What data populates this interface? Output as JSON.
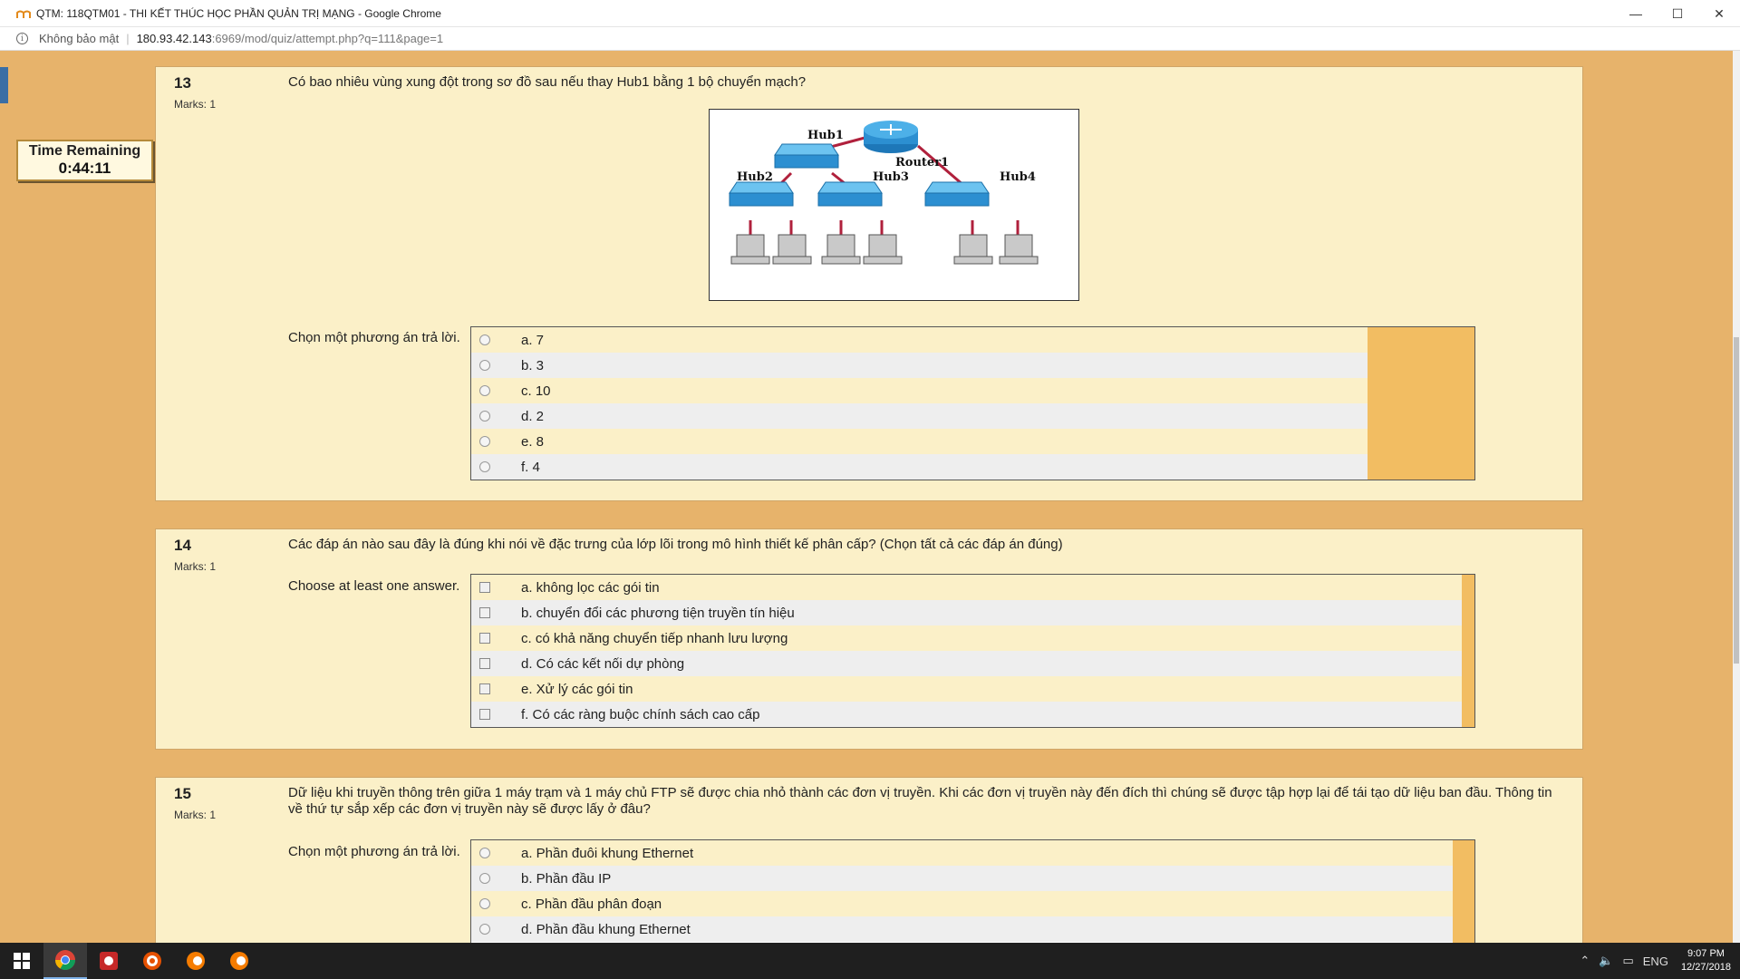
{
  "window": {
    "title": "QTM: 118QTM01 - THI KẾT THÚC HỌC PHẦN QUẢN TRỊ MẠNG - Google Chrome",
    "controls": {
      "minimize": "—",
      "maximize": "☐",
      "close": "✕"
    }
  },
  "address": {
    "security": "Không bảo mật",
    "host": "180.93.42.143",
    "path": ":6969/mod/quiz/attempt.php?q=111&page=1"
  },
  "timer": {
    "label": "Time Remaining",
    "value": "0:44:11"
  },
  "questions": [
    {
      "number": "13",
      "marks": "Marks: 1",
      "text": "Có bao nhiêu vùng xung đột trong sơ đồ sau nếu thay Hub1 bằng 1 bộ chuyển mạch?",
      "prompt": "Chọn một phương án trả lời.",
      "diagram": {
        "hub1": "Hub1",
        "router": "Router1",
        "hub2": "Hub2",
        "hub3": "Hub3",
        "hub4": "Hub4"
      },
      "options": [
        "a. 7",
        "b. 3",
        "c. 10",
        "d. 2",
        "e. 8",
        "f. 4"
      ]
    },
    {
      "number": "14",
      "marks": "Marks: 1",
      "text": "Các đáp án nào sau đây là đúng khi nói về đặc trưng của lớp lõi trong mô hình thiết kế phân cấp? (Chọn tất cả các đáp án đúng)",
      "prompt": "Choose at least one answer.",
      "options": [
        "a. không lọc các gói tin",
        "b. chuyển đổi các phương tiện truyền tín hiệu",
        "c. có khả năng chuyển tiếp nhanh lưu lượng",
        "d. Có các kết nối dự phòng",
        "e. Xử lý các gói tin",
        "f. Có các ràng buộc chính sách cao cấp"
      ]
    },
    {
      "number": "15",
      "marks": "Marks: 1",
      "text": "Dữ liệu khi truyền thông trên giữa 1 máy trạm và 1 máy chủ FTP sẽ được chia nhỏ thành các đơn vị truyền. Khi các đơn vị truyền này đến đích thì chúng sẽ được tập hợp lại để tái tạo dữ liệu ban đầu. Thông tin về thứ tự sắp xếp các đơn vị truyền này sẽ được lấy ở đâu?",
      "prompt": "Chọn một phương án trả lời.",
      "options": [
        "a. Phần đuôi khung Ethernet",
        "b. Phần đầu IP",
        "c. Phần đầu phân đoạn",
        "d. Phần đầu khung Ethernet"
      ]
    }
  ],
  "tray": {
    "lang": "ENG",
    "time": "9:07 PM",
    "date": "12/27/2018"
  },
  "colors": {
    "page_bg": "#e7b36b",
    "question_bg": "#fbf0c8",
    "answer_stripe": "#f2bd62",
    "taskbar": "#1f1f1f"
  }
}
